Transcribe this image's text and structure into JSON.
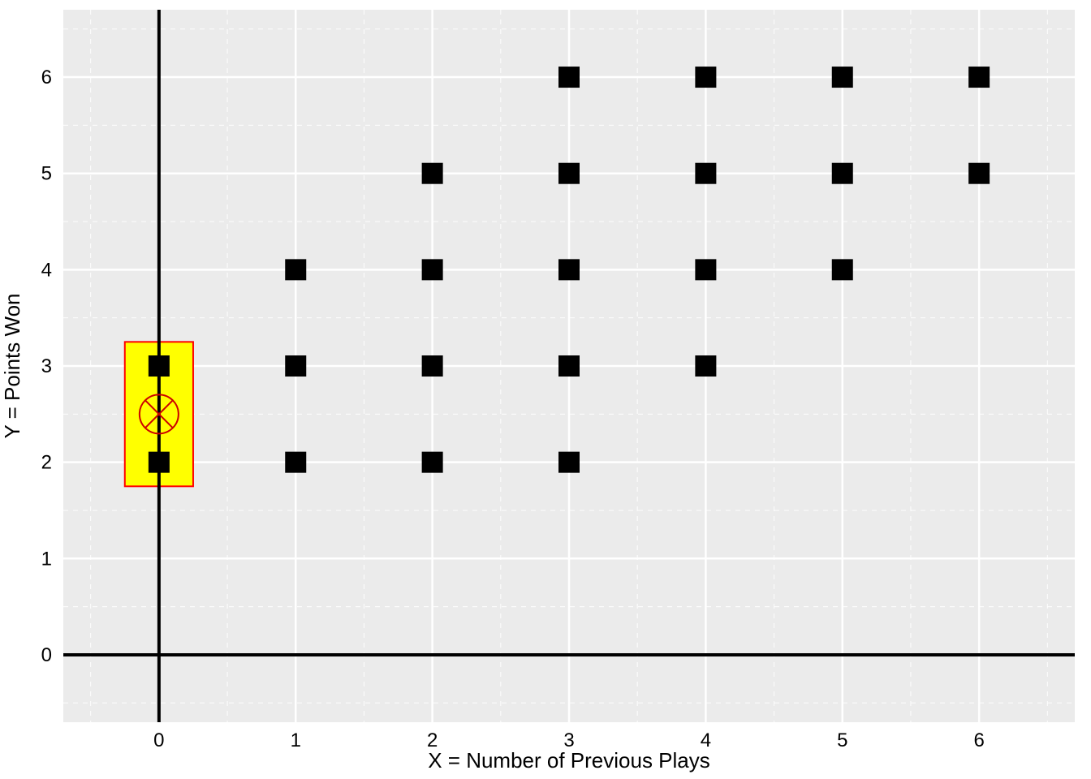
{
  "chart_data": {
    "type": "scatter",
    "xlabel": "X = Number of Previous Plays",
    "ylabel": "Y = Points Won",
    "xlim": [
      -0.7,
      6.7
    ],
    "ylim": [
      -0.7,
      6.7
    ],
    "x_ticks": [
      0,
      1,
      2,
      3,
      4,
      5,
      6
    ],
    "y_ticks": [
      0,
      1,
      2,
      3,
      4,
      5,
      6
    ],
    "points": [
      {
        "x": 0,
        "y": 2
      },
      {
        "x": 0,
        "y": 3
      },
      {
        "x": 1,
        "y": 2
      },
      {
        "x": 1,
        "y": 3
      },
      {
        "x": 1,
        "y": 4
      },
      {
        "x": 2,
        "y": 2
      },
      {
        "x": 2,
        "y": 3
      },
      {
        "x": 2,
        "y": 4
      },
      {
        "x": 2,
        "y": 5
      },
      {
        "x": 3,
        "y": 2
      },
      {
        "x": 3,
        "y": 3
      },
      {
        "x": 3,
        "y": 4
      },
      {
        "x": 3,
        "y": 5
      },
      {
        "x": 3,
        "y": 6
      },
      {
        "x": 4,
        "y": 3
      },
      {
        "x": 4,
        "y": 4
      },
      {
        "x": 4,
        "y": 5
      },
      {
        "x": 4,
        "y": 6
      },
      {
        "x": 5,
        "y": 4
      },
      {
        "x": 5,
        "y": 5
      },
      {
        "x": 5,
        "y": 6
      },
      {
        "x": 6,
        "y": 5
      },
      {
        "x": 6,
        "y": 6
      }
    ],
    "highlight_rect": {
      "xmin": -0.25,
      "xmax": 0.25,
      "ymin": 1.75,
      "ymax": 3.25
    },
    "marker": {
      "x": 0,
      "y": 2.5,
      "type": "crossed-circle"
    }
  }
}
